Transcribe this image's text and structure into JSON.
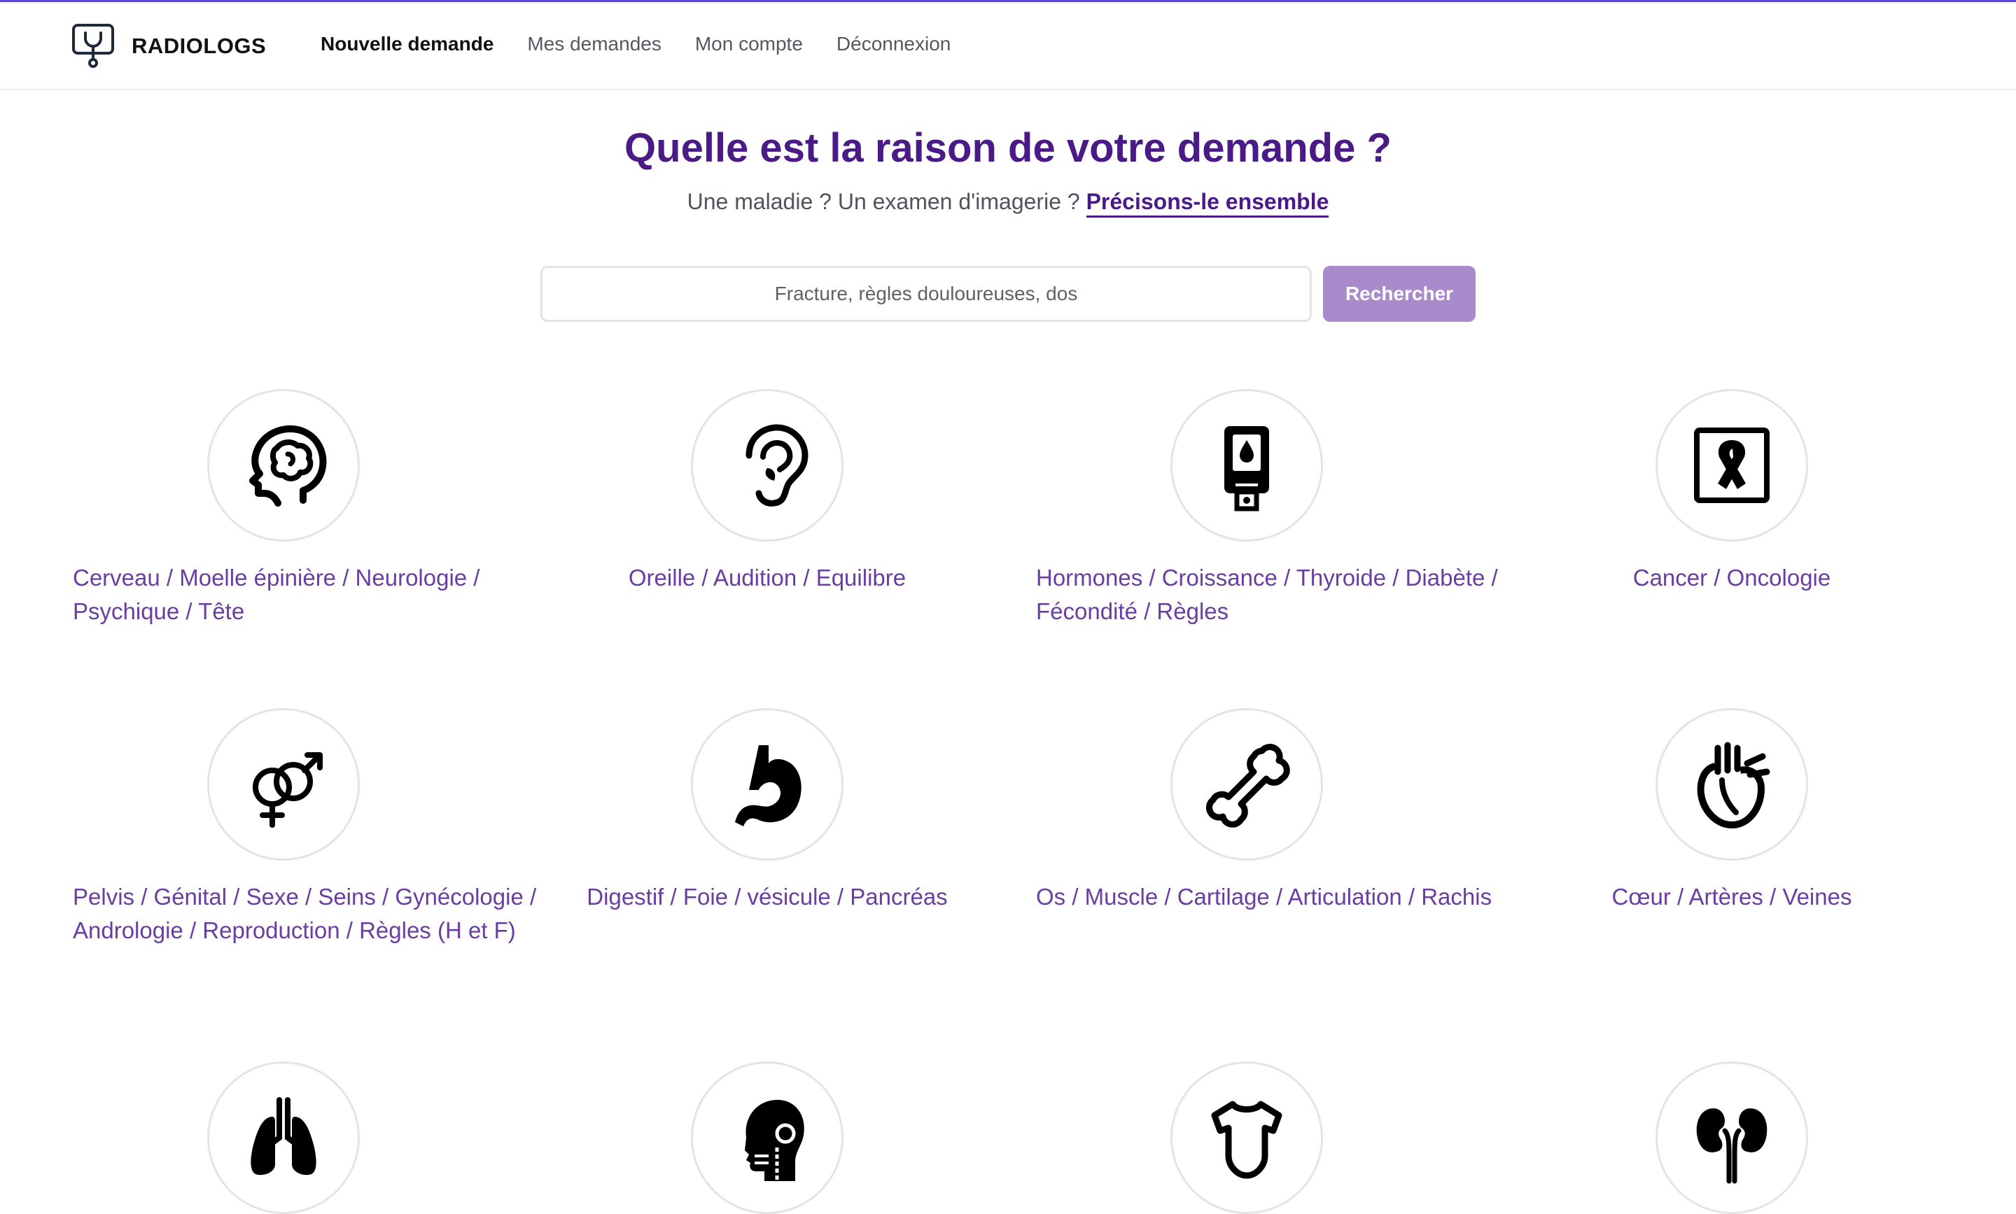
{
  "navbar": {
    "brand": "RADIOLOGS",
    "links": [
      {
        "label": "Nouvelle demande",
        "active": true
      },
      {
        "label": "Mes demandes"
      },
      {
        "label": "Mon compte"
      },
      {
        "label": "Déconnexion"
      }
    ]
  },
  "hero": {
    "title": "Quelle est la raison de votre demande ?",
    "subtitle": "Une maladie ? Un examen d'imagerie ?",
    "subtitle_link": "Précisons-le ensemble"
  },
  "search": {
    "placeholder": "Fracture, règles douloureuses, dos",
    "button": "Rechercher"
  },
  "categories": [
    {
      "label": "Cerveau / Moelle épinière / Neurologie / Psychique / Tête",
      "icon": "brain-head-icon"
    },
    {
      "label": "Oreille / Audition / Equilibre",
      "icon": "ear-icon"
    },
    {
      "label": "Hormones / Croissance / Thyroide / Diabète / Fécondité / Règles",
      "icon": "glucometer-icon"
    },
    {
      "label": "Cancer / Oncologie",
      "icon": "cancer-ribbon-icon"
    },
    {
      "label": "Pelvis / Génital / Sexe / Seins / Gynécologie / Andrologie / Reproduction / Règles (H et F)",
      "icon": "gender-symbols-icon"
    },
    {
      "label": "Digestif / Foie / vésicule / Pancréas",
      "icon": "stomach-icon"
    },
    {
      "label": "Os / Muscle / Cartilage / Articulation / Rachis",
      "icon": "bone-icon"
    },
    {
      "label": "Cœur / Artères / Veines",
      "icon": "heart-icon"
    },
    {
      "label": "",
      "icon": "lungs-icon"
    },
    {
      "label": "",
      "icon": "head-profile-icon"
    },
    {
      "label": "",
      "icon": "baby-bodysuit-icon"
    },
    {
      "label": "",
      "icon": "kidneys-icon"
    }
  ],
  "colors": {
    "accent": "#4a1b86",
    "category_text": "#6a3ea1",
    "button": "#a98bcc"
  }
}
